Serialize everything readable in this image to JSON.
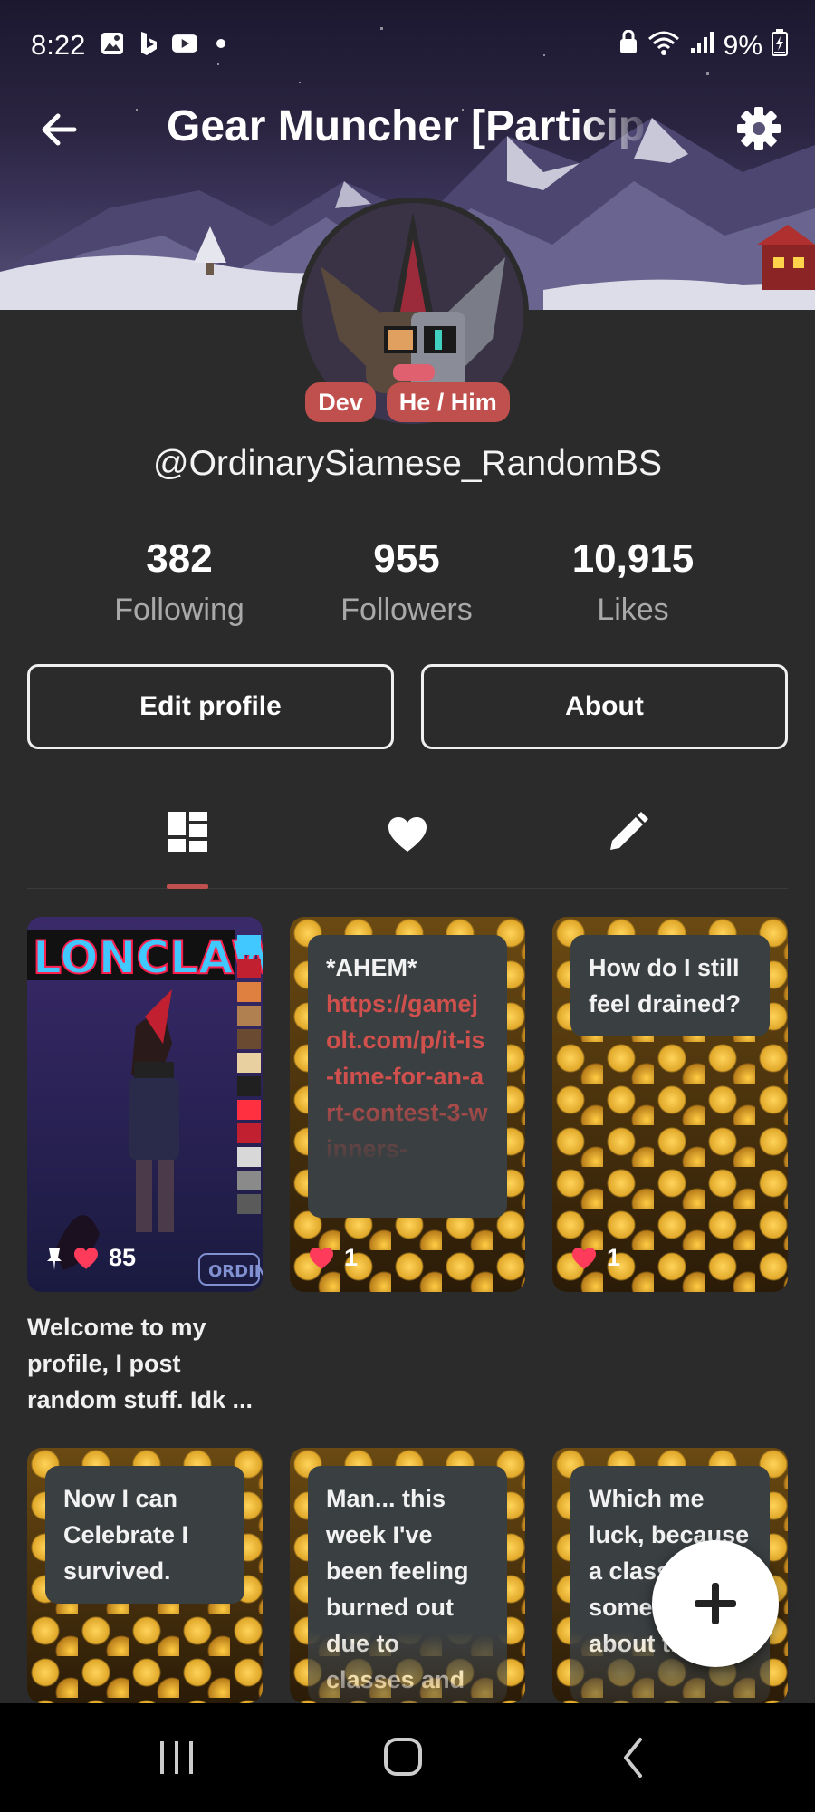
{
  "status": {
    "time": "8:22",
    "battery": "9%"
  },
  "appbar": {
    "title": "Gear Muncher [Particip"
  },
  "profile": {
    "badges": [
      "Dev",
      "He / Him"
    ],
    "username": "@OrdinarySiamese_RandomBS"
  },
  "stats": [
    {
      "value": "382",
      "label": "Following"
    },
    {
      "value": "955",
      "label": "Followers"
    },
    {
      "value": "10,915",
      "label": "Likes"
    }
  ],
  "buttons": {
    "edit_profile": "Edit profile",
    "about": "About"
  },
  "tabs": [
    "grid-icon",
    "heart-icon",
    "pencil-icon"
  ],
  "posts": [
    {
      "type": "image",
      "likes": "85",
      "pinned": true,
      "image_text": "LONCLAW",
      "watermark": "ORDIN",
      "caption": "Welcome to my profile, I post random stuff. Idk ..."
    },
    {
      "type": "text",
      "text": "*AHEM*",
      "link": "https://gamejolt.com/p/it-is-time-for-an-art-contest-3-winners-",
      "likes": "1"
    },
    {
      "type": "text",
      "text": "How do I still feel drained?",
      "likes": "1"
    },
    {
      "type": "text",
      "text": "Now I can Celebrate I survived."
    },
    {
      "type": "text",
      "text": "Man... this week I've been feeling burned out due to classes and"
    },
    {
      "type": "text",
      "text": "Which me luck, because a class said something about there"
    }
  ],
  "colors": {
    "accent": "#c0504d",
    "background": "#2b2b2b",
    "like": "#ff3b5c"
  }
}
